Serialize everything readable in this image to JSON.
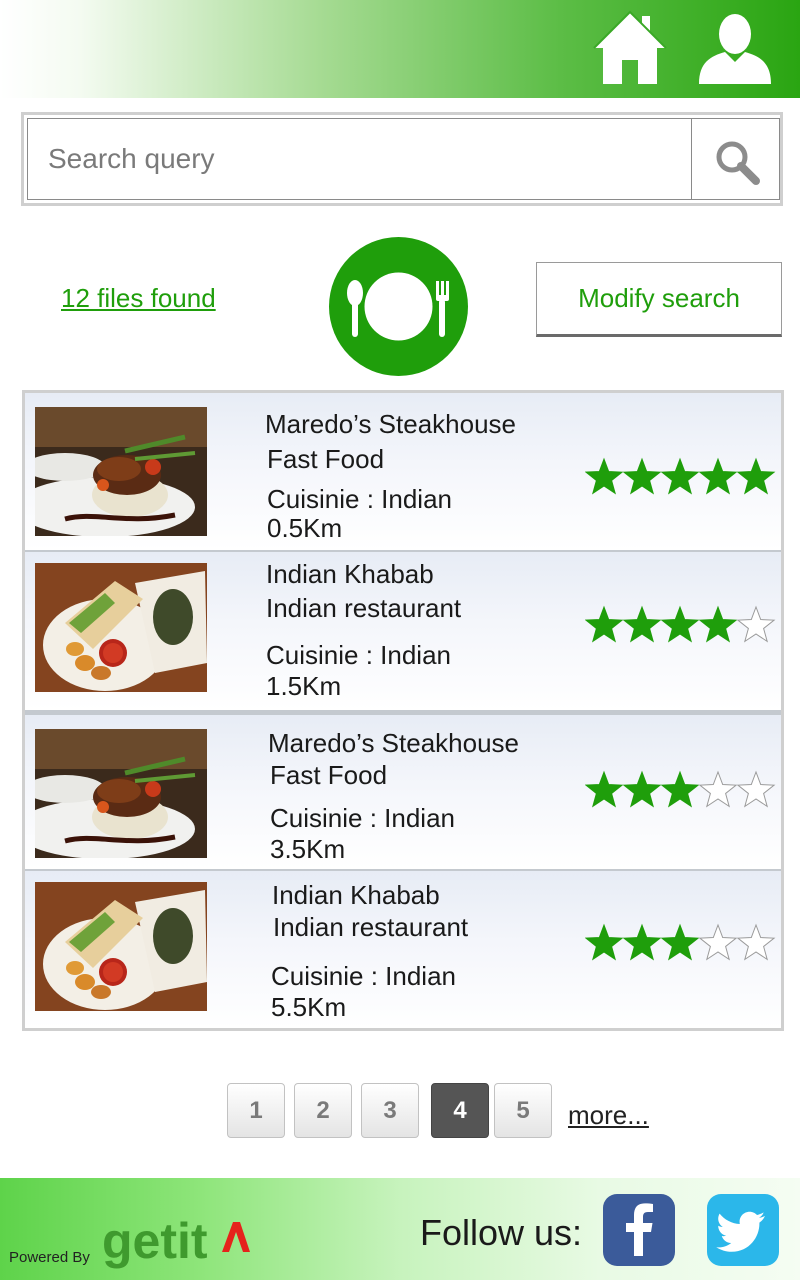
{
  "colors": {
    "accent": "#1f9e0b",
    "star": "#1f9e0b",
    "facebook": "#3b5b9a",
    "twitter": "#2bb7ea"
  },
  "header": {
    "icons": [
      "home-icon",
      "user-icon"
    ]
  },
  "search": {
    "placeholder": "Search query",
    "value": "",
    "icon": "search-icon"
  },
  "results": {
    "files_found": "12 files found",
    "modify_label": "Modify search",
    "logo_icon": "plate-fork-spoon-icon"
  },
  "listings": [
    {
      "name": "Maredo’s Steakhouse",
      "category": "Fast Food",
      "cuisine": "Cuisinie : Indian",
      "distance": "0.5Km",
      "rating": 5,
      "photo": "steak-dish-photo"
    },
    {
      "name": "Indian Khabab",
      "category": "Indian restaurant",
      "cuisine": "Cuisinie : Indian",
      "distance": "1.5Km",
      "rating": 4,
      "photo": "wrap-dish-photo"
    },
    {
      "name": "Maredo’s Steakhouse",
      "category": "Fast Food",
      "cuisine": "Cuisinie : Indian",
      "distance": "3.5Km",
      "rating": 3,
      "photo": "steak-dish-photo"
    },
    {
      "name": "Indian Khabab",
      "category": "Indian restaurant",
      "cuisine": "Cuisinie : Indian",
      "distance": "5.5Km",
      "rating": 3,
      "photo": "wrap-dish-photo"
    }
  ],
  "pagination": {
    "pages": [
      "1",
      "2",
      "3",
      "4",
      "5"
    ],
    "current": "4",
    "more_label": "more..."
  },
  "footer": {
    "powered_by": "Powered By",
    "brand": "getit",
    "follow_label": "Follow us:",
    "social": [
      "facebook-icon",
      "twitter-icon"
    ]
  }
}
